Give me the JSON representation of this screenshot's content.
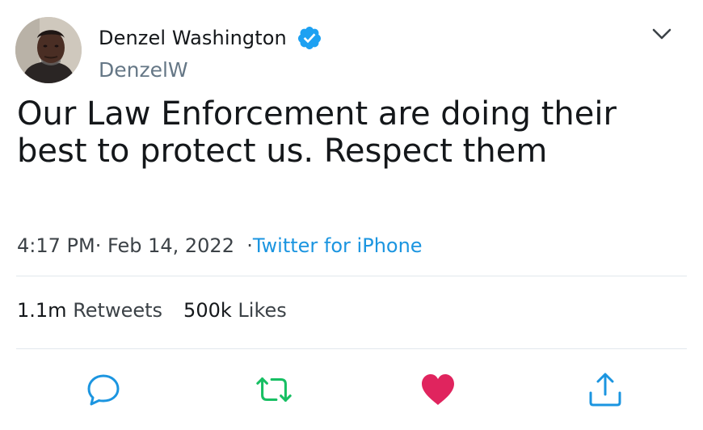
{
  "author": {
    "display_name": "Denzel Washington",
    "handle": "DenzelW",
    "verified": true,
    "avatar": "profile-photo"
  },
  "tweet": {
    "text": "Our Law Enforcement are doing their best to protect us. Respect them",
    "time": "4:17 PM",
    "date": "Feb 14, 2022",
    "source": "Twitter for iPhone"
  },
  "stats": {
    "retweets_count": "1.1m",
    "retweets_label": "Retweets",
    "likes_count": "500k",
    "likes_label": "Likes"
  },
  "actions": {
    "reply_icon": "reply-icon",
    "retweet_icon": "retweet-icon",
    "like_icon": "like-icon",
    "share_icon": "share-icon"
  },
  "colors": {
    "text": "#14171a",
    "secondary": "#657786",
    "link": "#1b95e0",
    "verified": "#1da1f2",
    "retweet": "#17bf63",
    "like": "#e0245e",
    "divider": "#e1e8ed"
  }
}
